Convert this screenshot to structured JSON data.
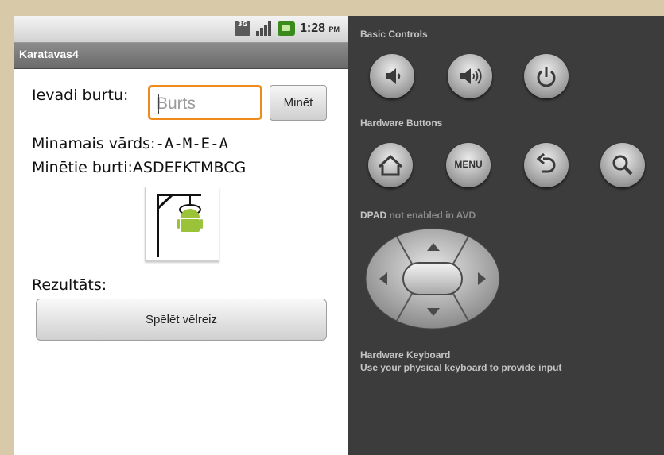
{
  "status_bar": {
    "network_badge_top": "3G",
    "network_badge_bottom": "",
    "time": "1:28",
    "ampm": "PM",
    "icons": [
      "3g-icon",
      "signal-icon",
      "battery-icon"
    ]
  },
  "app": {
    "title": "Karatavas4",
    "input_label": "Ievadi burtu:",
    "input_placeholder": "Burts",
    "guess_button": "Minēt",
    "word_label": "Minamais vārds:",
    "word_value": "-A-M-E-A",
    "guessed_label": "Minētie burti:",
    "guessed_value": "ASDEFKTMBCG",
    "result_label": "Rezultāts:",
    "play_again_button": "Spēlēt vēlreiz"
  },
  "controls": {
    "basic_title": "Basic Controls",
    "basic_buttons": [
      "volume-down-icon",
      "volume-up-icon",
      "power-icon"
    ],
    "hardware_title": "Hardware Buttons",
    "hardware_buttons": [
      "home-icon",
      "menu",
      "back-icon",
      "search-icon"
    ],
    "menu_label": "MENU",
    "dpad_title_bold": "DPAD",
    "dpad_title_rest": " not enabled in AVD",
    "keyboard_title": "Hardware Keyboard",
    "keyboard_desc": "Use your physical keyboard to provide input"
  },
  "colors": {
    "focus_orange": "#ef8b1a",
    "panel_bg": "#3c3c3c",
    "titlebar": "#6a6a6a"
  }
}
